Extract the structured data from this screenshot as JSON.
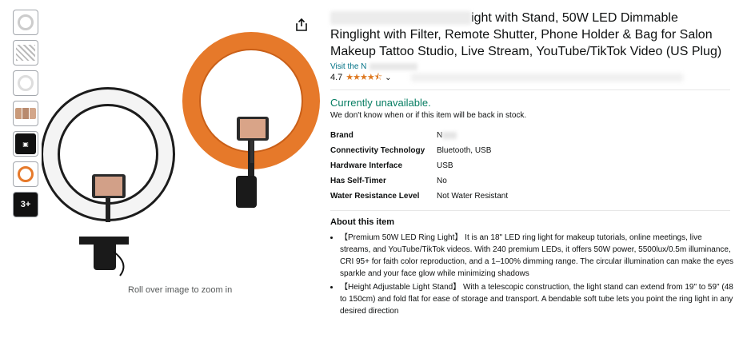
{
  "product": {
    "title_visible": "ight with Stand, 50W LED Dimmable Ringlight with Filter, Remote Shutter, Phone Holder & Bag for Salon Makeup Tattoo Studio, Live Stream, YouTube/TikTok Video (US Plug)",
    "store_prefix": "Visit the N",
    "rating": "4.7",
    "stars": "★★★★⯪"
  },
  "availability": {
    "status": "Currently unavailable.",
    "note": "We don't know when or if this item will be back in stock."
  },
  "specs": [
    {
      "key": "Brand",
      "value": "N"
    },
    {
      "key": "Connectivity Technology",
      "value": "Bluetooth, USB"
    },
    {
      "key": "Hardware Interface",
      "value": "USB"
    },
    {
      "key": "Has Self-Timer",
      "value": "No"
    },
    {
      "key": "Water Resistance Level",
      "value": "Not Water Resistant"
    }
  ],
  "about": {
    "title": "About this item",
    "bullets": [
      "【Premium 50W LED Ring Light】 It is an 18\" LED ring light for makeup tutorials, online meetings, live streams, and YouTube/TikTok videos. With 240 premium LEDs, it offers 50W power, 5500lux/0.5m illuminance, CRI 95+ for faith color reproduction, and a 1–100% dimming range. The circular illumination can make the eyes sparkle and your face glow while minimizing shadows",
      "【Height Adjustable Light Stand】 With a telescopic construction, the light stand can extend from 19\" to 59\" (48 to 150cm) and fold flat for ease of storage and transport. A bendable soft tube lets you point the ring light in any desired direction"
    ]
  },
  "gallery": {
    "more_label": "3+",
    "zoom_hint": "Roll over image to zoom in",
    "icons": [
      "share-icon",
      "chevron-down-icon"
    ]
  },
  "colors": {
    "link": "#007185",
    "available_green": "#067d62",
    "star": "#de7921",
    "ring_orange": "#e6792a"
  }
}
